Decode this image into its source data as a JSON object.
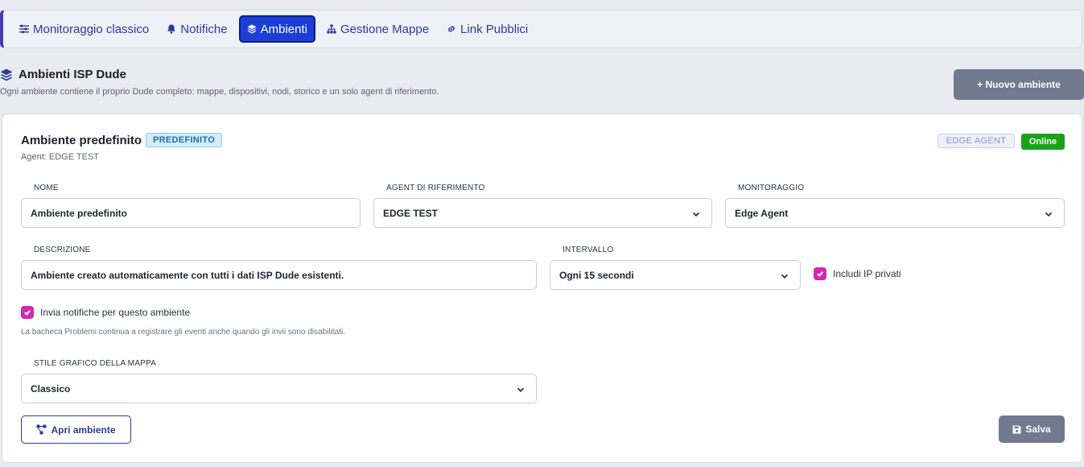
{
  "nav": {
    "items": [
      {
        "label": "Monitoraggio classico",
        "icon": "sliders-icon",
        "active": false
      },
      {
        "label": "Notifiche",
        "icon": "bell-icon",
        "active": false
      },
      {
        "label": "Ambienti",
        "icon": "layers-icon",
        "active": true
      },
      {
        "label": "Gestione Mappe",
        "icon": "sitemap-icon",
        "active": false
      },
      {
        "label": "Link Pubblici",
        "icon": "link-icon",
        "active": false
      }
    ]
  },
  "header": {
    "title": "Ambienti ISP Dude",
    "subtitle": "Ogni ambiente contiene il proprio Dude completo: mappe, dispositivi, nodi, storico e un solo agent di riferimento.",
    "new_button": "+ Nuovo ambiente"
  },
  "environment": {
    "title": "Ambiente predefinito",
    "default_badge": "PREDEFINITO",
    "agent_line": "Agent: EDGE TEST",
    "agent_type_badge": "EDGE AGENT",
    "status_badge": "Online",
    "status_color": "#1aa31a",
    "fields": {
      "name": {
        "label": "NOME",
        "value": "Ambiente predefinito"
      },
      "agent": {
        "label": "AGENT DI RIFERIMENTO",
        "value": "EDGE TEST"
      },
      "monitoring": {
        "label": "MONITORAGGIO",
        "value": "Edge Agent"
      },
      "description": {
        "label": "DESCRIZIONE",
        "value": "Ambiente creato automaticamente con tutti i dati ISP Dude esistenti."
      },
      "interval": {
        "label": "INTERVALLO",
        "value": "Ogni 15 secondi"
      },
      "map_style": {
        "label": "STILE GRAFICO DELLA MAPPA",
        "value": "Classico"
      }
    },
    "private_ip": {
      "label": "Includi IP privati",
      "checked": true
    },
    "send_notifications": {
      "label": "Invia notifiche per questo ambiente",
      "checked": true
    },
    "hint": "La bacheca Problemi continua a registrare gli eventi anche quando gli invii sono disabilitati.",
    "open_button": "Apri ambiente",
    "save_button": "Salva"
  },
  "colors": {
    "accent": "#1c3ed6",
    "nav_text": "#2c3a9a",
    "checkbox": "#d627b2",
    "button_gray": "#727a8f"
  }
}
